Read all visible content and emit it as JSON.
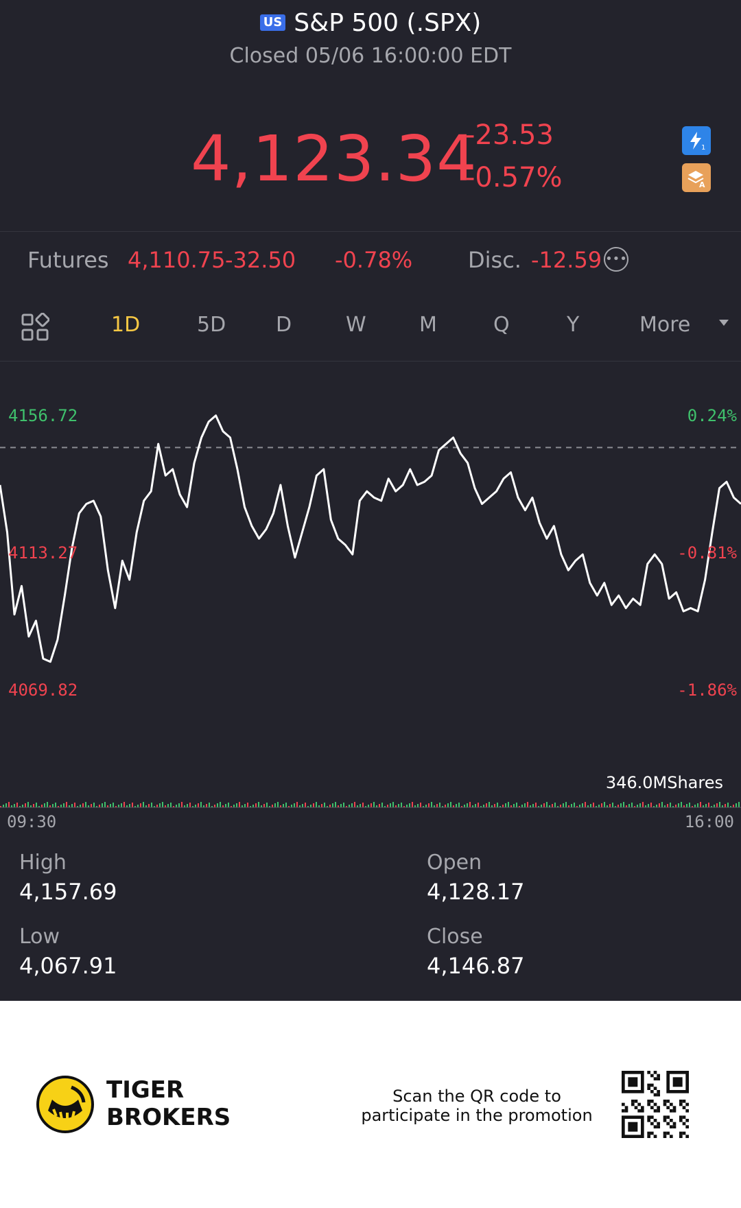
{
  "header": {
    "region_badge": "US",
    "title": "S&P 500 (.SPX)",
    "status": "Closed 05/06 16:00:00 EDT"
  },
  "quote": {
    "price": "4,123.34",
    "change": "-23.53",
    "change_pct": "-0.57%",
    "color_down": "#f0434f",
    "color_up": "#3fc16c"
  },
  "futures": {
    "label": "Futures",
    "price": "4,110.75",
    "change": "-32.50",
    "change_pct": "-0.78%",
    "disc_label": "Disc.",
    "disc_value": "-12.59"
  },
  "tabs": {
    "items": [
      "1D",
      "5D",
      "D",
      "W",
      "M",
      "Q",
      "Y",
      "More"
    ],
    "active": "1D",
    "active_color": "#f7c844"
  },
  "chart_data": {
    "type": "line",
    "y_axis_left": [
      "4156.72",
      "4113.27",
      "4069.82"
    ],
    "y_axis_right": [
      "0.24%",
      "-0.81%",
      "-1.86%"
    ],
    "ylim": [
      4069.82,
      4156.72
    ],
    "prev_close": 4146.87,
    "x_labels": [
      "09:30",
      "16:00"
    ],
    "volume_label": "346.0MShares",
    "series": [
      {
        "values": [
          4135,
          4120,
          4094,
          4103,
          4087,
          4092,
          4080,
          4079,
          4086,
          4100,
          4115,
          4126,
          4129,
          4130,
          4125,
          4108,
          4096,
          4111,
          4105,
          4120,
          4130,
          4133,
          4148,
          4138,
          4140,
          4132,
          4128,
          4142,
          4150,
          4155,
          4157,
          4152,
          4150,
          4140,
          4128,
          4122,
          4118,
          4121,
          4126,
          4135,
          4122,
          4112,
          4120,
          4128,
          4138,
          4140,
          4124,
          4118,
          4116,
          4113,
          4130,
          4133,
          4131,
          4130,
          4137,
          4133,
          4135,
          4140,
          4135,
          4136,
          4138,
          4146,
          4148,
          4150,
          4145,
          4142,
          4134,
          4129,
          4131,
          4133,
          4137,
          4139,
          4131,
          4127,
          4131,
          4123,
          4118,
          4122,
          4113,
          4108,
          4111,
          4113,
          4104,
          4100,
          4104,
          4097,
          4100,
          4096,
          4099,
          4097,
          4110,
          4113,
          4110,
          4099,
          4101,
          4095,
          4096,
          4095,
          4105,
          4120,
          4134,
          4136,
          4131,
          4129
        ]
      }
    ],
    "line_color": "#ffffff",
    "ref_line": "dashed"
  },
  "stats": {
    "high_label": "High",
    "high": "4,157.69",
    "open_label": "Open",
    "open": "4,128.17",
    "low_label": "Low",
    "low": "4,067.91",
    "close_label": "Close",
    "close": "4,146.87"
  },
  "footer": {
    "brand_line1": "TIGER",
    "brand_line2": "BROKERS",
    "promo_line1": "Scan the QR code to",
    "promo_line2": "participate in the promotion"
  },
  "icons": {
    "flash": "flash-icon",
    "edu": "education-icon",
    "grid": "layout-grid-icon",
    "more": "more-options-icon",
    "logo": "tiger-logo-icon",
    "qr": "qr-code-icon"
  }
}
